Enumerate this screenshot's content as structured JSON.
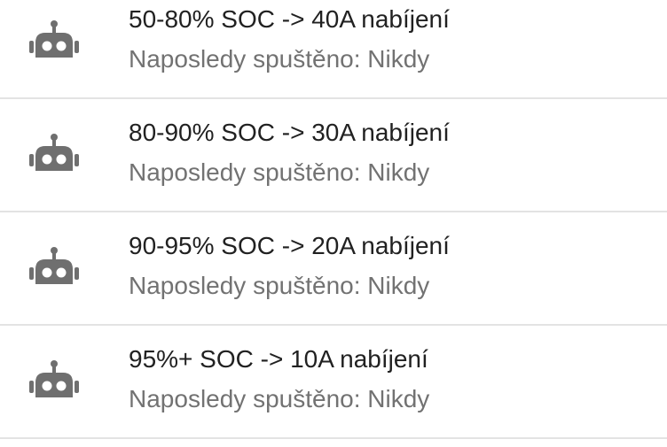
{
  "automations": [
    {
      "title": "50-80% SOC -> 40A nabíjení",
      "subtitle": "Naposledy spuštěno: Nikdy",
      "icon": "robot-icon"
    },
    {
      "title": "80-90% SOC -> 30A nabíjení",
      "subtitle": "Naposledy spuštěno: Nikdy",
      "icon": "robot-icon"
    },
    {
      "title": "90-95% SOC -> 20A nabíjení",
      "subtitle": "Naposledy spuštěno: Nikdy",
      "icon": "robot-icon"
    },
    {
      "title": "95%+ SOC -> 10A nabíjení",
      "subtitle": "Naposledy spuštěno: Nikdy",
      "icon": "robot-icon"
    }
  ],
  "colors": {
    "title": "#212121",
    "subtitle": "#727272",
    "icon": "#6f6f6f",
    "divider": "#e3e3e3"
  }
}
